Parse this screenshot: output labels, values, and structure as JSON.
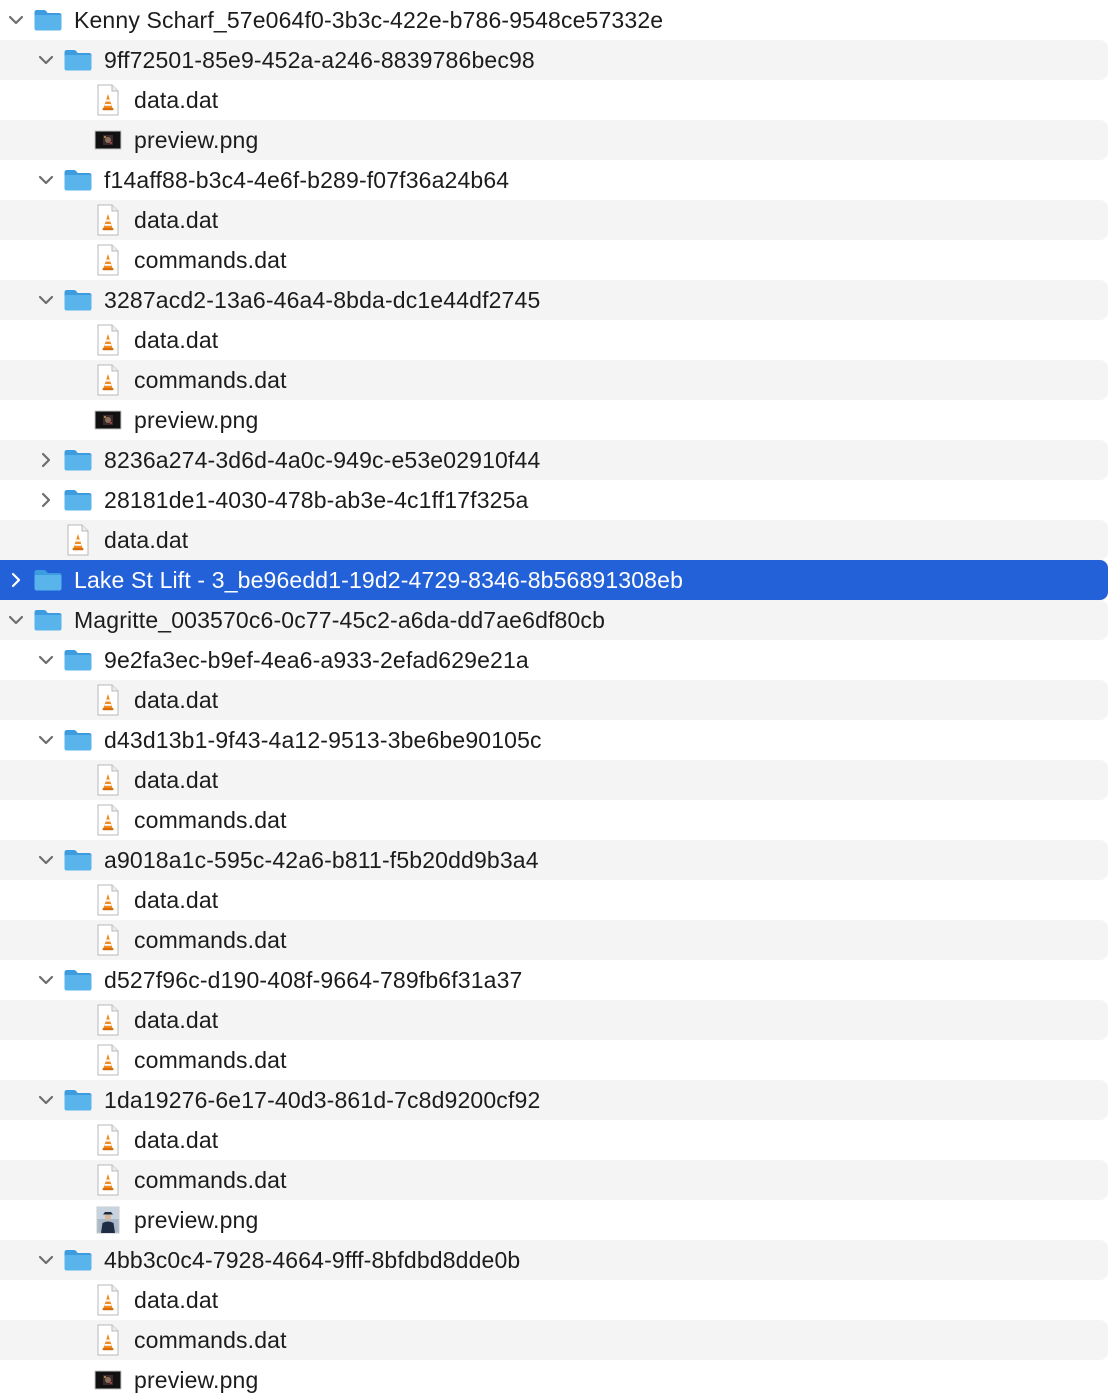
{
  "window": {
    "view": "Finder list view"
  },
  "rows": [
    {
      "label": "Kenny Scharf_57e064f0-3b3c-422e-b786-9548ce57332e",
      "depth": 0,
      "kind": "folder",
      "expanded": true,
      "selected": false
    },
    {
      "label": "9ff72501-85e9-452a-a246-8839786bec98",
      "depth": 1,
      "kind": "folder",
      "expanded": true,
      "selected": false
    },
    {
      "label": "data.dat",
      "depth": 2,
      "kind": "dat",
      "selected": false
    },
    {
      "label": "preview.png",
      "depth": 2,
      "kind": "png-dark",
      "selected": false
    },
    {
      "label": "f14aff88-b3c4-4e6f-b289-f07f36a24b64",
      "depth": 1,
      "kind": "folder",
      "expanded": true,
      "selected": false
    },
    {
      "label": "data.dat",
      "depth": 2,
      "kind": "dat",
      "selected": false
    },
    {
      "label": "commands.dat",
      "depth": 2,
      "kind": "dat",
      "selected": false
    },
    {
      "label": "3287acd2-13a6-46a4-8bda-dc1e44df2745",
      "depth": 1,
      "kind": "folder",
      "expanded": true,
      "selected": false
    },
    {
      "label": "data.dat",
      "depth": 2,
      "kind": "dat",
      "selected": false
    },
    {
      "label": "commands.dat",
      "depth": 2,
      "kind": "dat",
      "selected": false
    },
    {
      "label": "preview.png",
      "depth": 2,
      "kind": "png-dark",
      "selected": false
    },
    {
      "label": "8236a274-3d6d-4a0c-949c-e53e02910f44",
      "depth": 1,
      "kind": "folder",
      "expanded": false,
      "selected": false
    },
    {
      "label": "28181de1-4030-478b-ab3e-4c1ff17f325a",
      "depth": 1,
      "kind": "folder",
      "expanded": false,
      "selected": false
    },
    {
      "label": "data.dat",
      "depth": 1,
      "kind": "dat",
      "selected": false
    },
    {
      "label": "Lake St Lift - 3_be96edd1-19d2-4729-8346-8b56891308eb",
      "depth": 0,
      "kind": "folder",
      "expanded": false,
      "selected": true
    },
    {
      "label": "Magritte_003570c6-0c77-45c2-a6da-dd7ae6df80cb",
      "depth": 0,
      "kind": "folder",
      "expanded": true,
      "selected": false
    },
    {
      "label": "9e2fa3ec-b9ef-4ea6-a933-2efad629e21a",
      "depth": 1,
      "kind": "folder",
      "expanded": true,
      "selected": false
    },
    {
      "label": "data.dat",
      "depth": 2,
      "kind": "dat",
      "selected": false
    },
    {
      "label": "d43d13b1-9f43-4a12-9513-3be6be90105c",
      "depth": 1,
      "kind": "folder",
      "expanded": true,
      "selected": false
    },
    {
      "label": "data.dat",
      "depth": 2,
      "kind": "dat",
      "selected": false
    },
    {
      "label": "commands.dat",
      "depth": 2,
      "kind": "dat",
      "selected": false
    },
    {
      "label": "a9018a1c-595c-42a6-b811-f5b20dd9b3a4",
      "depth": 1,
      "kind": "folder",
      "expanded": true,
      "selected": false
    },
    {
      "label": "data.dat",
      "depth": 2,
      "kind": "dat",
      "selected": false
    },
    {
      "label": "commands.dat",
      "depth": 2,
      "kind": "dat",
      "selected": false
    },
    {
      "label": "d527f96c-d190-408f-9664-789fb6f31a37",
      "depth": 1,
      "kind": "folder",
      "expanded": true,
      "selected": false
    },
    {
      "label": "data.dat",
      "depth": 2,
      "kind": "dat",
      "selected": false
    },
    {
      "label": "commands.dat",
      "depth": 2,
      "kind": "dat",
      "selected": false
    },
    {
      "label": "1da19276-6e17-40d3-861d-7c8d9200cf92",
      "depth": 1,
      "kind": "folder",
      "expanded": true,
      "selected": false
    },
    {
      "label": "data.dat",
      "depth": 2,
      "kind": "dat",
      "selected": false
    },
    {
      "label": "commands.dat",
      "depth": 2,
      "kind": "dat",
      "selected": false
    },
    {
      "label": "preview.png",
      "depth": 2,
      "kind": "png-photo",
      "selected": false
    },
    {
      "label": "4bb3c0c4-7928-4664-9fff-8bfdbd8dde0b",
      "depth": 1,
      "kind": "folder",
      "expanded": true,
      "selected": false
    },
    {
      "label": "data.dat",
      "depth": 2,
      "kind": "dat",
      "selected": false
    },
    {
      "label": "commands.dat",
      "depth": 2,
      "kind": "dat",
      "selected": false
    },
    {
      "label": "preview.png",
      "depth": 2,
      "kind": "png-dark",
      "selected": false
    }
  ],
  "icons": {
    "folder": "folder-icon",
    "dat": "vlc-document-icon",
    "png-dark": "image-thumbnail-icon",
    "png-photo": "image-thumbnail-icon",
    "chevron_expanded": "chevron-down-icon",
    "chevron_collapsed": "chevron-right-icon"
  },
  "colors": {
    "selection": "#2361d8",
    "stripe": "#f4f4f4",
    "folder_body": "#5ab4ec",
    "folder_tab": "#3d9be0",
    "vlc_cone": "#f08a1c",
    "text": "#1c1c1c"
  }
}
